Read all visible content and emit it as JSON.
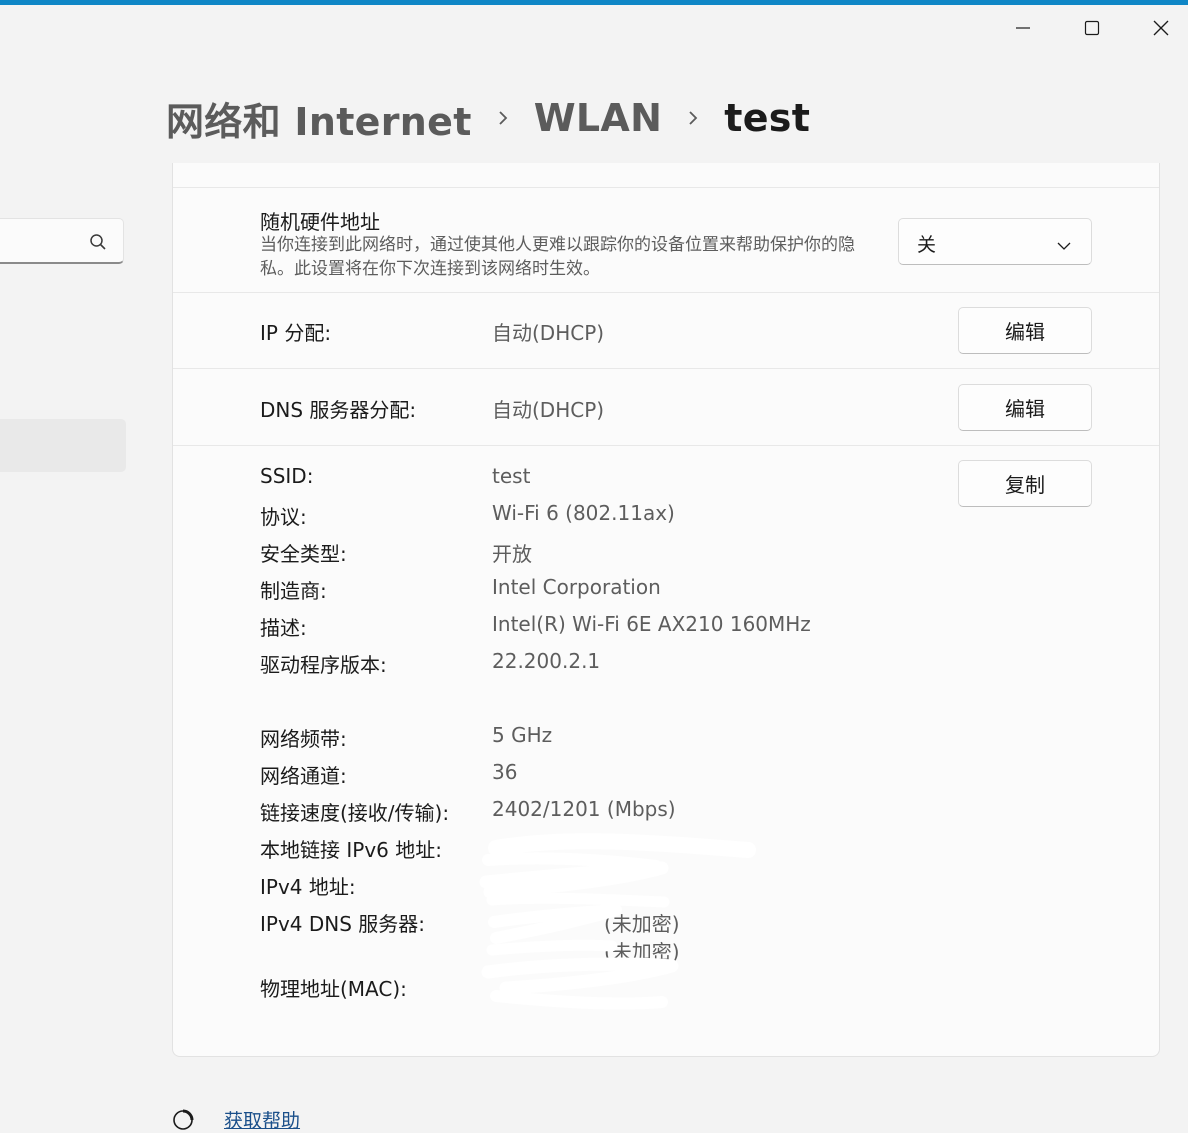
{
  "window": {
    "accent_color": "#0f86c6",
    "controls": [
      "minimize-icon",
      "maximize-icon",
      "close-icon"
    ]
  },
  "breadcrumb": {
    "items": [
      "网络和 Internet",
      "WLAN",
      "test"
    ]
  },
  "settings": {
    "random_mac": {
      "title": "随机硬件地址",
      "description": "当你连接到此网络时，通过使其他人更难以跟踪你的设备位置来帮助保护你的隐私。此设置将在你下次连接到该网络时生效。",
      "selected": "关"
    },
    "ip_assignment": {
      "label": "IP 分配:",
      "value": "自动(DHCP)",
      "button": "编辑"
    },
    "dns_assignment": {
      "label": "DNS 服务器分配:",
      "value": "自动(DHCP)",
      "button": "编辑"
    },
    "copy_button": "复制"
  },
  "properties": [
    {
      "label": "SSID:",
      "value": "test"
    },
    {
      "label": "协议:",
      "value": "Wi-Fi 6 (802.11ax)"
    },
    {
      "label": "安全类型:",
      "value": "开放"
    },
    {
      "label": "制造商:",
      "value": "Intel Corporation"
    },
    {
      "label": "描述:",
      "value": "Intel(R) Wi-Fi 6E AX210 160MHz"
    },
    {
      "label": "驱动程序版本:",
      "value": "22.200.2.1"
    },
    {
      "label": "网络频带:",
      "value": "5 GHz"
    },
    {
      "label": "网络通道:",
      "value": "36"
    },
    {
      "label": "链接速度(接收/传输):",
      "value": "2402/1201 (Mbps)"
    },
    {
      "label": "本地链接 IPv6 地址:",
      "value": ""
    },
    {
      "label": "IPv4 地址:",
      "value": ""
    },
    {
      "label": "IPv4 DNS 服务器:",
      "value": "",
      "values": [
        "(未加密)",
        "(未加密)"
      ]
    },
    {
      "label": "物理地址(MAC):",
      "value": ""
    }
  ],
  "help": {
    "label": "获取帮助"
  }
}
